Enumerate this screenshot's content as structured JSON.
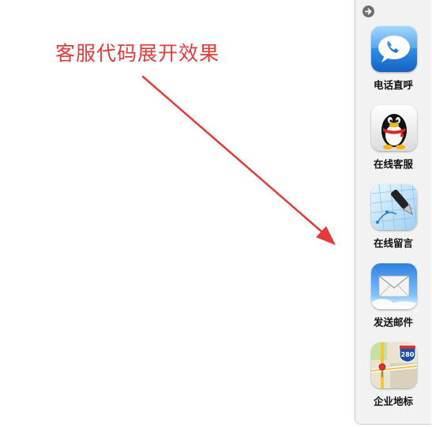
{
  "headline": "客服代码展开效果",
  "colors": {
    "headline": "#e53a3a",
    "arrow": "#e53a3a",
    "panel_bg": "#f2f2f2"
  },
  "panel": {
    "collapse_icon": "arrow-right-icon",
    "items": [
      {
        "label": "电话直呼",
        "icon": "phone-bubble-icon"
      },
      {
        "label": "在线客服",
        "icon": "qq-penguin-icon"
      },
      {
        "label": "在线留言",
        "icon": "fountain-pen-icon"
      },
      {
        "label": "发送邮件",
        "icon": "mail-envelope-icon"
      },
      {
        "label": "企业地标",
        "icon": "map-pin-icon",
        "shield_number": "280"
      }
    ]
  }
}
